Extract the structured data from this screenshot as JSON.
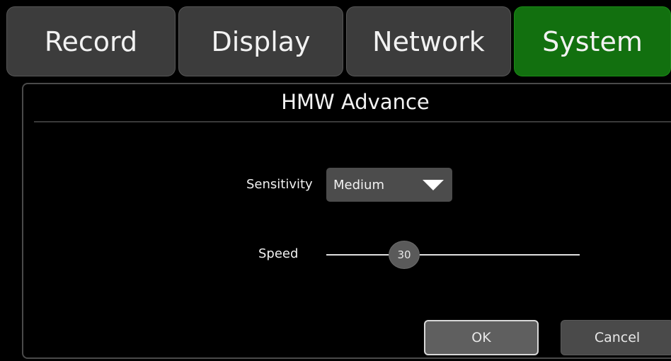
{
  "tabs": [
    {
      "label": "Record",
      "active": false
    },
    {
      "label": "Display",
      "active": false
    },
    {
      "label": "Network",
      "active": false
    },
    {
      "label": "System",
      "active": true
    }
  ],
  "panel": {
    "title": "HMW Advance",
    "sensitivity": {
      "label": "Sensitivity",
      "value": "Medium"
    },
    "speed": {
      "label": "Speed",
      "value": "30"
    },
    "buttons": {
      "ok": "OK",
      "cancel": "Cancel"
    }
  },
  "colors": {
    "active_tab": "#12700f",
    "inactive_tab": "#3c3c3c",
    "background": "#000000"
  }
}
